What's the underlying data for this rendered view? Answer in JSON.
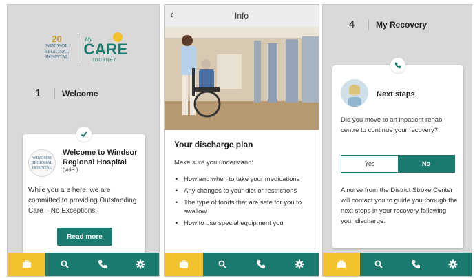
{
  "screen1": {
    "logo_windsor_number": "20",
    "logo_windsor_text": "WINDSOR REGIONAL HOSPITAL",
    "logo_care_my": "My",
    "logo_care_text": "CARE",
    "logo_care_journey": "JOURNEY",
    "step_number": "1",
    "step_title": "Welcome",
    "card": {
      "title": "Welcome to Windsor Regional Hospital",
      "subtitle": "(Video)",
      "body": "While you are here, we are committed to providing Outstanding Care – No Exceptions!",
      "button_label": "Read more"
    }
  },
  "screen2": {
    "header_title": "Info",
    "heading": "Your discharge plan",
    "intro": "Make sure you understand:",
    "bullets": [
      "How and when to take your medications",
      "Any changes to your diet or restrictions",
      "The type of foods that are safe for you to swallow",
      "How to use special equipment you"
    ]
  },
  "screen3": {
    "step_number": "4",
    "step_title": "My Recovery",
    "card": {
      "title": "Next steps",
      "question": "Did you move to an inpatient rehab centre to continue your recovery?",
      "yes_label": "Yes",
      "no_label": "No",
      "info": "A nurse from the District Stroke Center will contact you to guide you through the next steps in your recovery following your discharge."
    }
  },
  "navbar": {
    "icons": [
      "briefcase-icon",
      "search-icon",
      "phone-icon",
      "gear-icon"
    ],
    "active_index": 0
  },
  "colors": {
    "teal": "#1a7a6e",
    "yellow": "#f2c12e",
    "gray_bg": "#d9d9d9"
  }
}
